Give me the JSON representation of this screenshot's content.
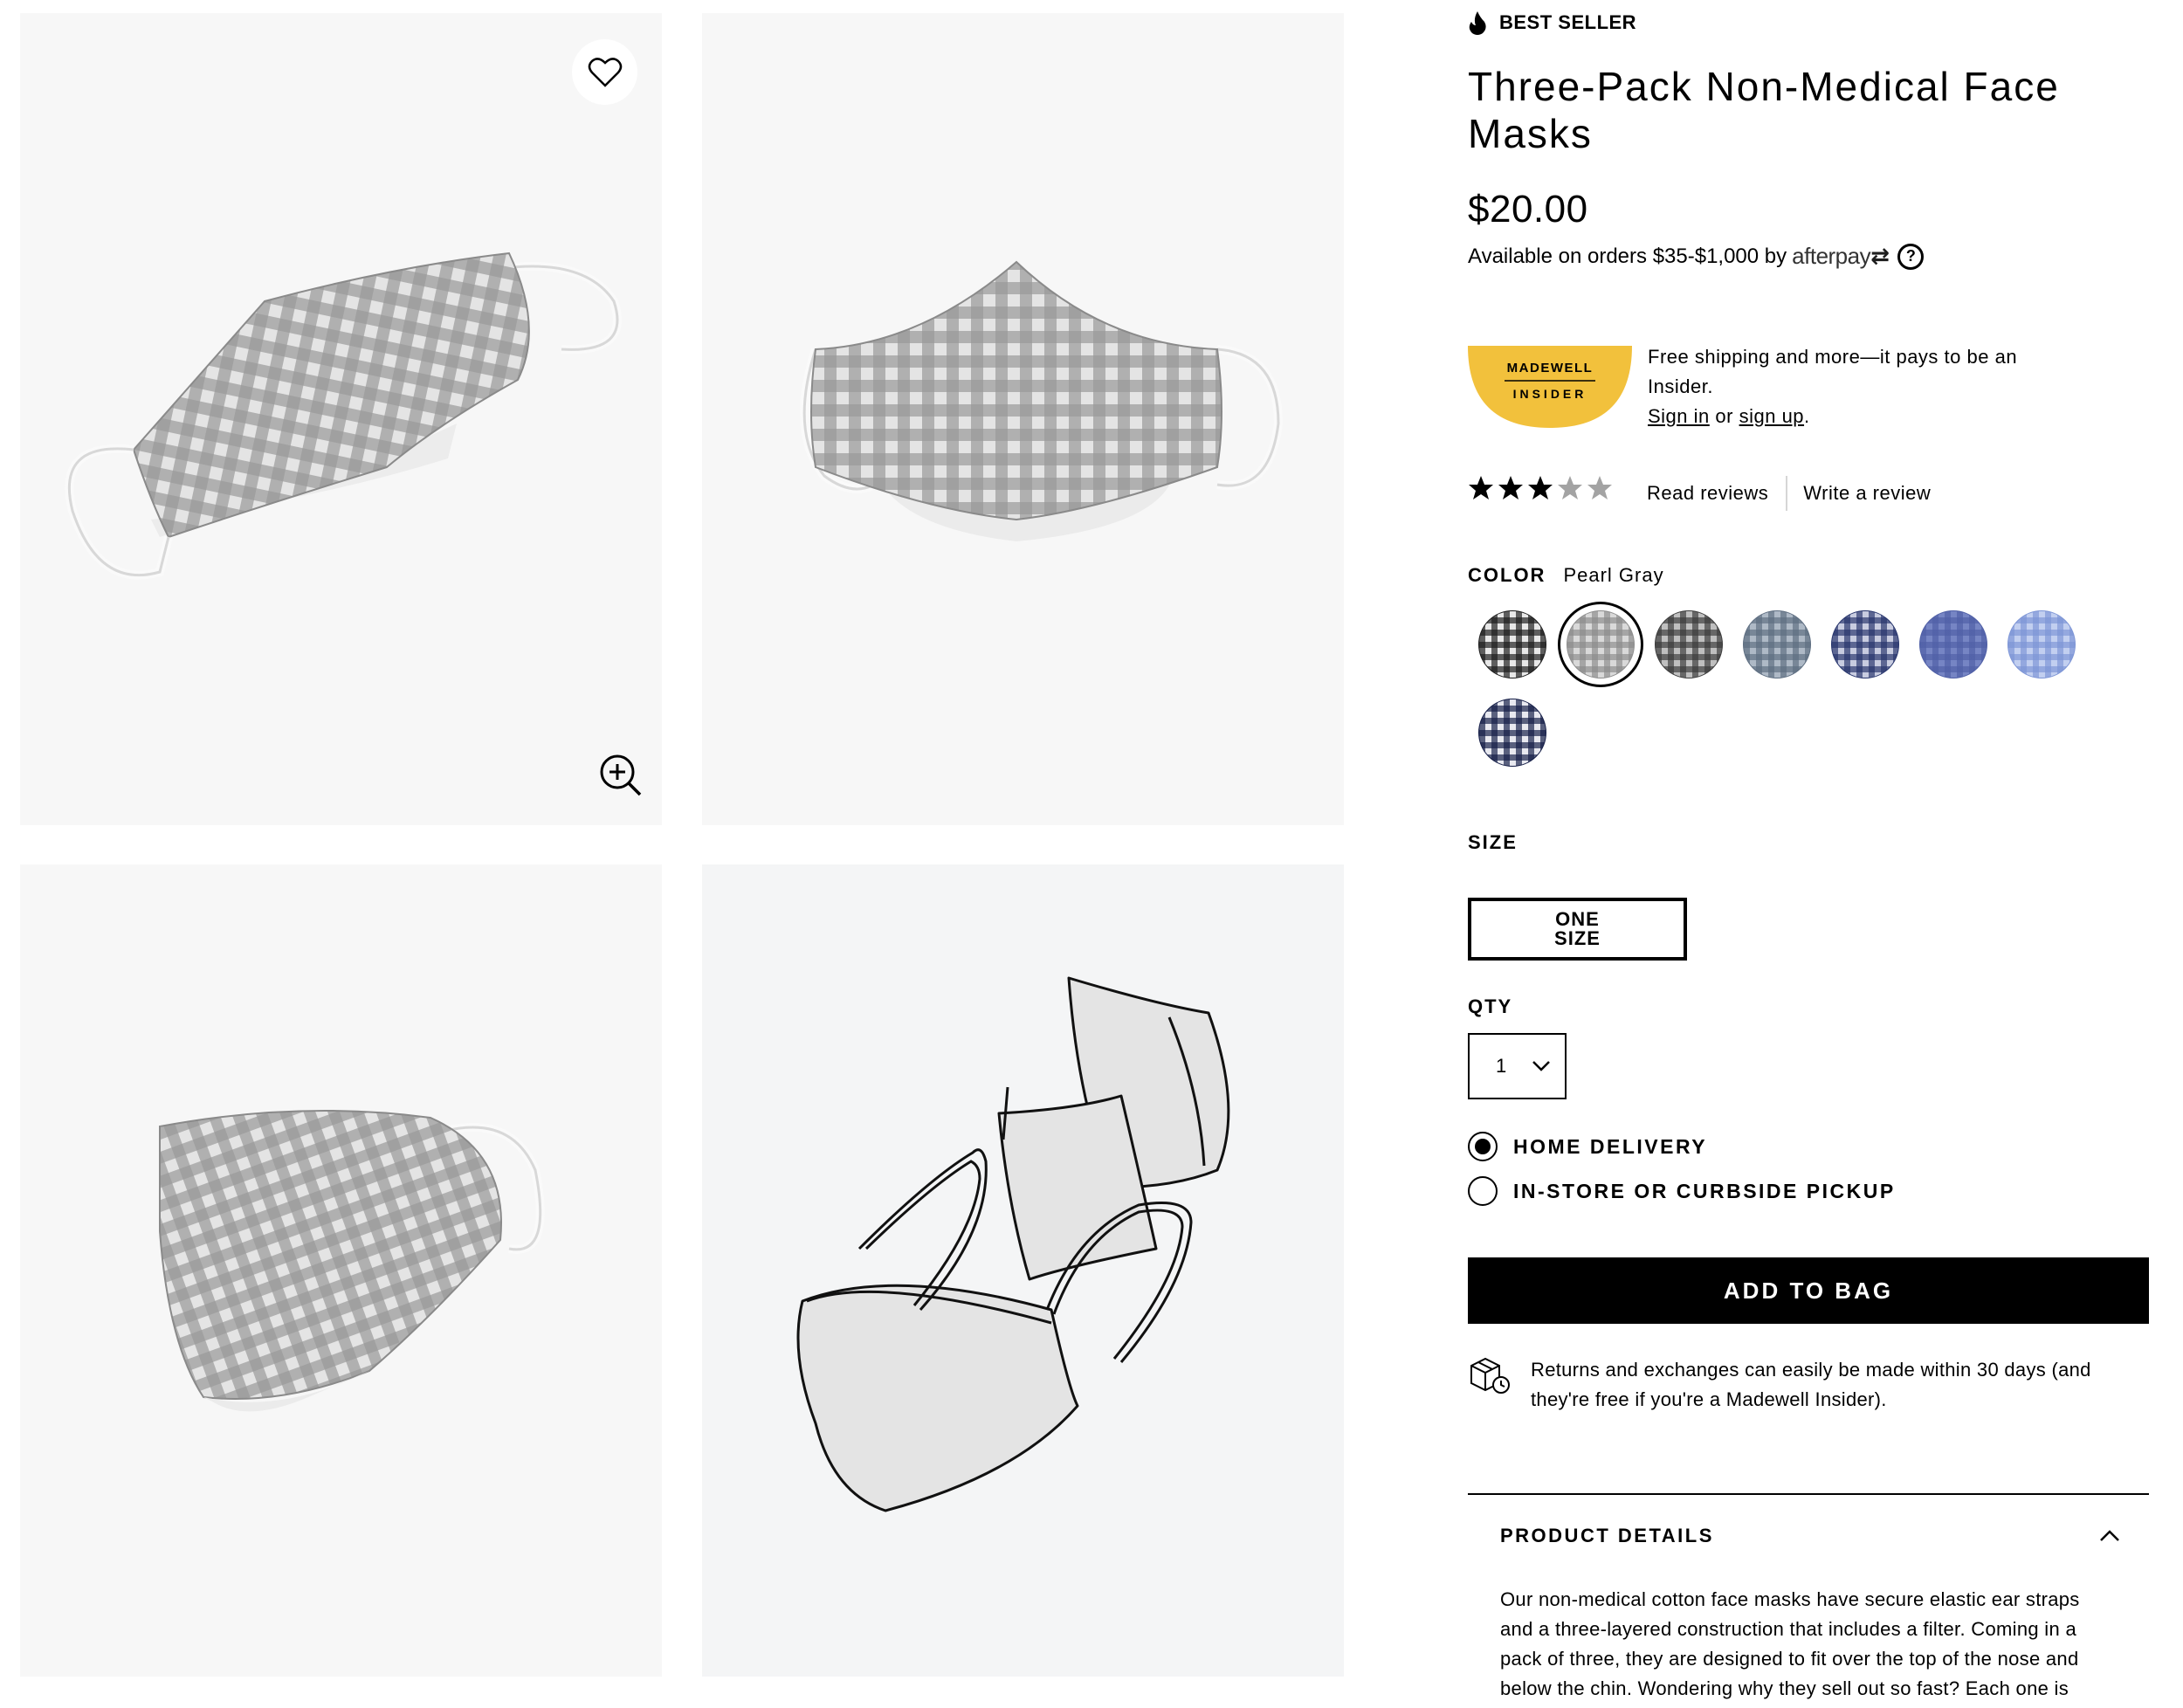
{
  "product": {
    "badge": "BEST SELLER",
    "title": "Three-Pack Non-Medical Face Masks",
    "price": "$20.00",
    "afterpay": {
      "text": "Available on orders $35-$1,000 by",
      "logo": "afterpay"
    }
  },
  "insider": {
    "badge_top": "MADEWELL",
    "badge_bottom": "INSIDER",
    "line1": "Free shipping and more—it pays to be an Insider.",
    "sign_in": "Sign in",
    "or": "or",
    "sign_up": "sign up",
    "period": ".",
    "badge_color": "#f2c13c"
  },
  "reviews": {
    "rating": 3,
    "max": 5,
    "read": "Read reviews",
    "write": "Write a review"
  },
  "color": {
    "label": "COLOR",
    "selected": "Pearl Gray",
    "swatches": [
      {
        "name": "black-gingham",
        "fg": "#1a1a1a",
        "bg": "#e8e8e8"
      },
      {
        "name": "pearl-gray",
        "fg": "#8c8c8c",
        "bg": "#d9d9d9"
      },
      {
        "name": "charcoal-plaid",
        "fg": "#3a3a3a",
        "bg": "#bfbfbf"
      },
      {
        "name": "blue-gray-plaid",
        "fg": "#5d6d80",
        "bg": "#aeb9c6"
      },
      {
        "name": "navy-stripe",
        "fg": "#25336b",
        "bg": "#c8cce0"
      },
      {
        "name": "chambray",
        "fg": "#4f5fa6",
        "bg": "#7685c4"
      },
      {
        "name": "light-blue-check",
        "fg": "#7d95d6",
        "bg": "#c2cff0"
      },
      {
        "name": "navy-gingham",
        "fg": "#121b45",
        "bg": "#e8e9f0"
      }
    ]
  },
  "size": {
    "label": "SIZE",
    "option": "ONE\nSIZE"
  },
  "qty": {
    "label": "QTY",
    "value": "1"
  },
  "fulfillment": {
    "home": "HOME DELIVERY",
    "pickup": "IN-STORE OR CURBSIDE PICKUP",
    "selected": "home"
  },
  "cta": {
    "add_to_bag": "ADD TO BAG"
  },
  "returns": {
    "text": "Returns and exchanges can easily be made within 30 days (and they're free if you're a Madewell Insider)."
  },
  "details": {
    "heading": "PRODUCT DETAILS",
    "body": "Our non-medical cotton face masks have secure elastic ear straps and a three-layered construction that includes a filter. Coming in a pack of three, they are designed to fit over the top of the nose and below the chin. Wondering why they sell out so fast? Each one is crafted from leftover fabric scraps,"
  }
}
